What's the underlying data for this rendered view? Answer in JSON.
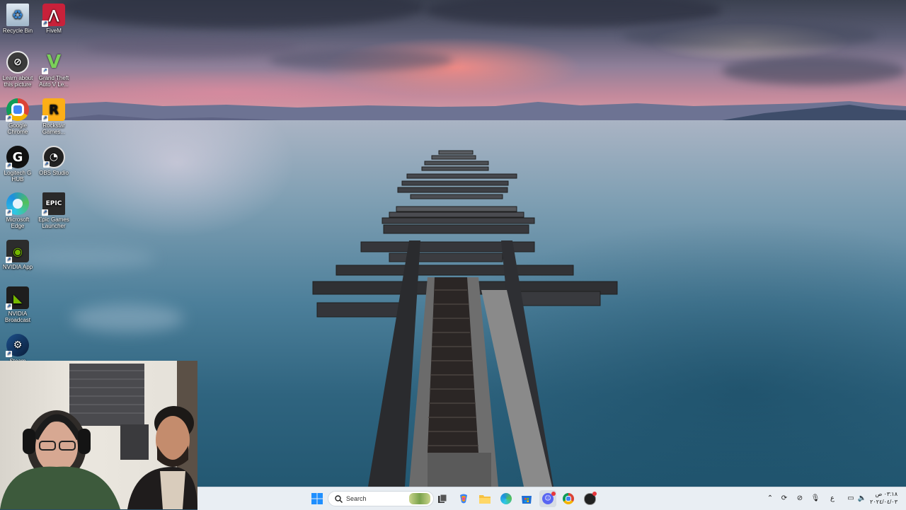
{
  "desktop": {
    "icons": [
      {
        "label": "Recycle Bin",
        "icon": "recycle-bin-icon"
      },
      {
        "label": "FiveM",
        "icon": "fivem-icon"
      },
      {
        "label": "Learn about this picture",
        "icon": "learn-about-picture-icon"
      },
      {
        "label": "Grand Theft Auto V Le...",
        "icon": "gta-v-icon"
      },
      {
        "label": "Google Chrome",
        "icon": "chrome-icon"
      },
      {
        "label": "Rockstar Games...",
        "icon": "rockstar-games-icon"
      },
      {
        "label": "Logitech G HUB",
        "icon": "logitech-g-hub-icon"
      },
      {
        "label": "OBS Studio",
        "icon": "obs-studio-icon"
      },
      {
        "label": "Microsoft Edge",
        "icon": "edge-icon"
      },
      {
        "label": "Epic Games Launcher",
        "icon": "epic-games-icon"
      },
      {
        "label": "NVIDIA App",
        "icon": "nvidia-app-icon"
      },
      {
        "label": "NVIDIA Broadcast",
        "icon": "nvidia-broadcast-icon"
      },
      {
        "label": "Steam",
        "icon": "steam-icon"
      }
    ]
  },
  "taskbar": {
    "search_placeholder": "Search",
    "apps": [
      {
        "name": "windows-start",
        "icon": "windows-logo-icon"
      },
      {
        "name": "search",
        "icon": "search-icon"
      },
      {
        "name": "task-view",
        "icon": "task-view-icon"
      },
      {
        "name": "copilot",
        "icon": "copilot-icon"
      },
      {
        "name": "file-explorer",
        "icon": "folder-icon"
      },
      {
        "name": "edge",
        "icon": "edge-icon"
      },
      {
        "name": "microsoft-store",
        "icon": "store-icon"
      },
      {
        "name": "discord",
        "icon": "discord-icon"
      },
      {
        "name": "chrome",
        "icon": "chrome-icon"
      },
      {
        "name": "obs",
        "icon": "obs-studio-icon"
      }
    ],
    "tray": {
      "language": "ع",
      "time": "٠٣:١٨ ص",
      "date": "٢٠٢٤/٠٤/٠٣"
    }
  },
  "colors": {
    "taskbar_bg": "#e9eef3",
    "accent_blue": "#1a64c8",
    "windows_blue": "#1f8fff"
  }
}
